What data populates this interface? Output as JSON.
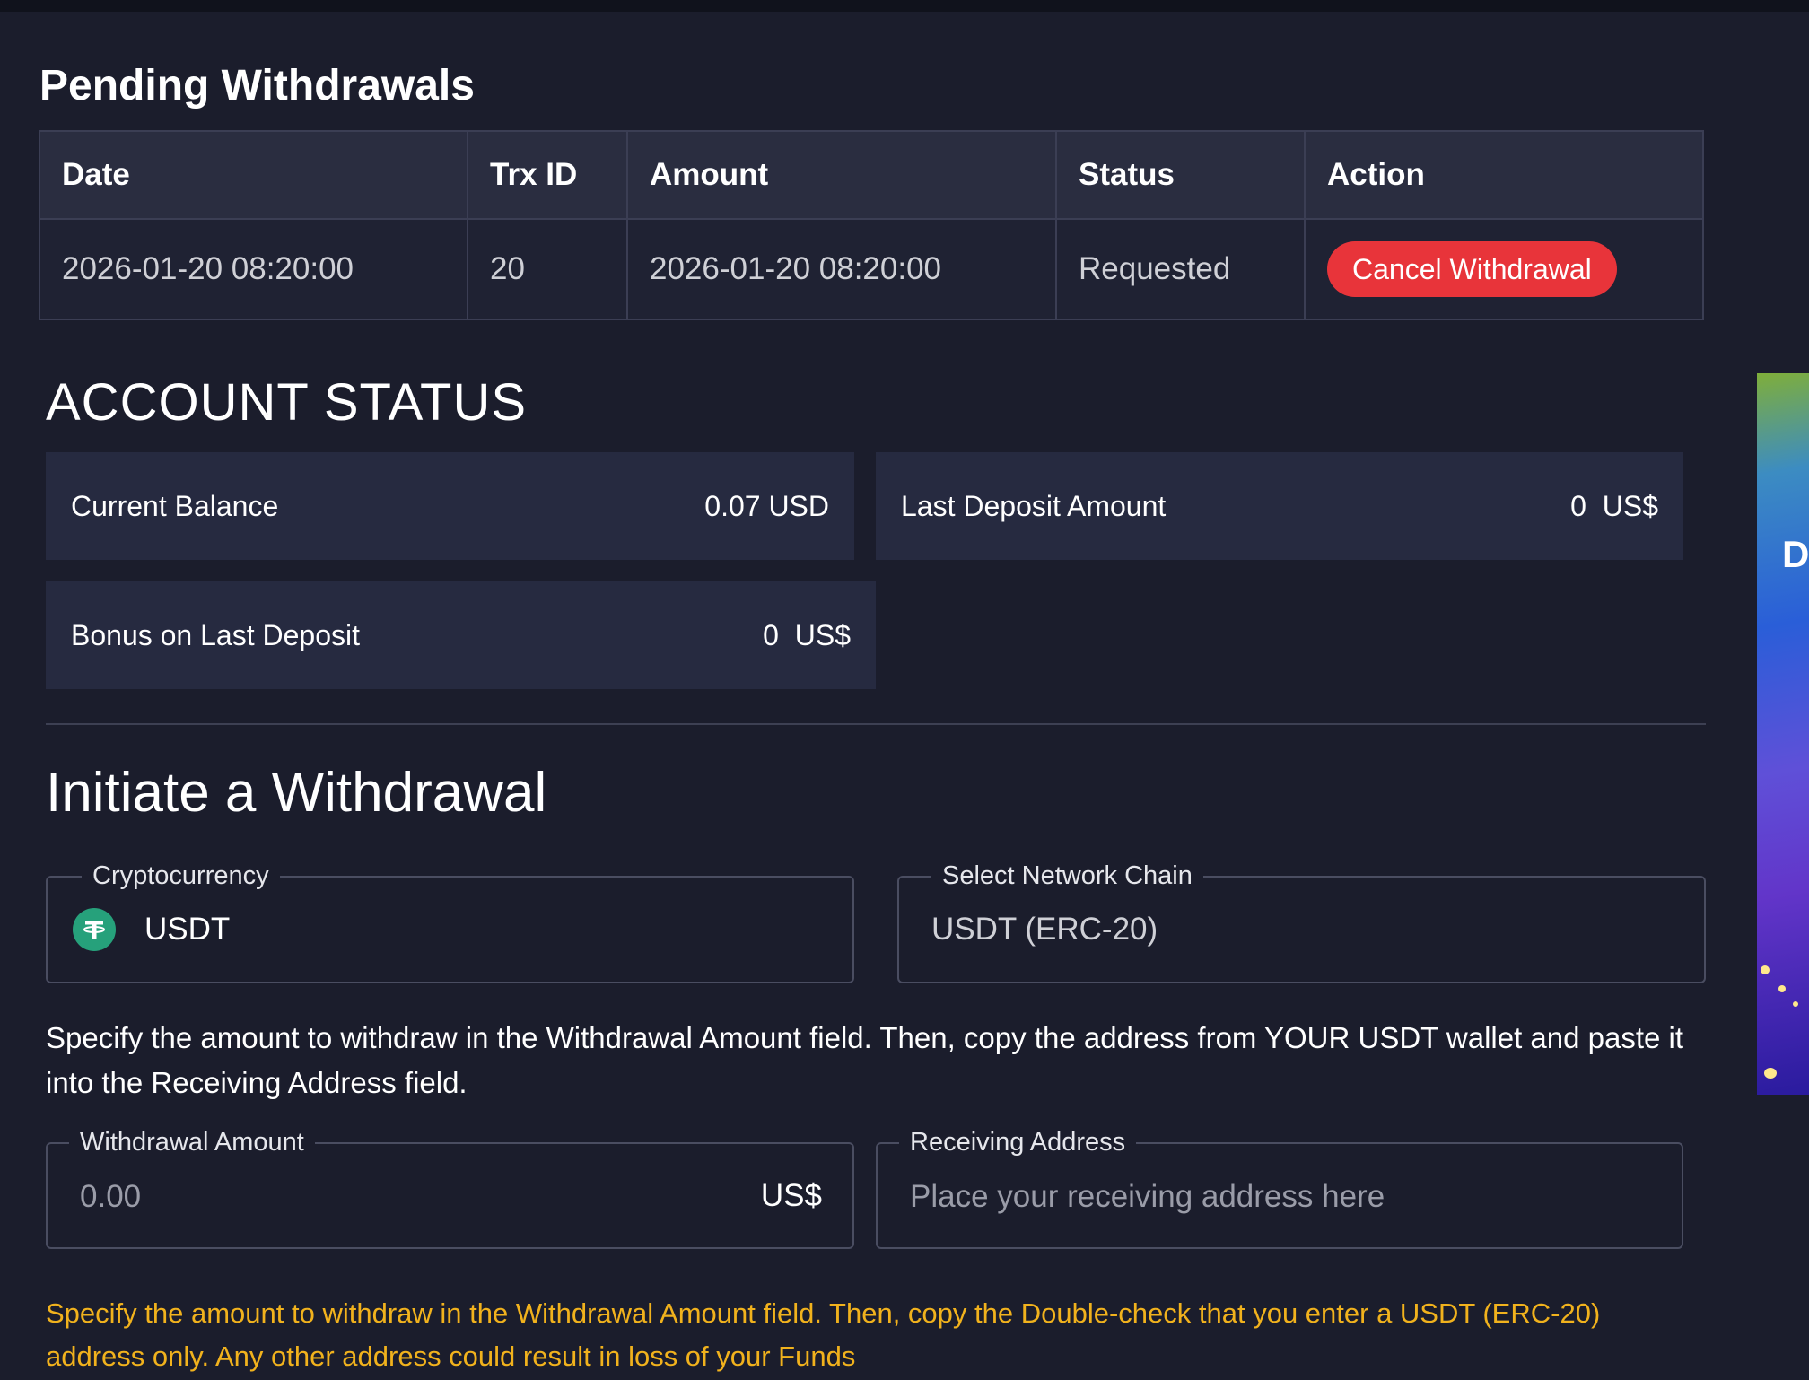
{
  "pending_withdrawals": {
    "title": "Pending Withdrawals",
    "columns": [
      "Date",
      "Trx ID",
      "Amount",
      "Status",
      "Action"
    ],
    "rows": [
      {
        "date": "2026-01-20 08:20:00",
        "trx_id": "20",
        "amount": "2026-01-20 08:20:00",
        "status": "Requested",
        "action_label": "Cancel Withdrawal"
      }
    ]
  },
  "account_status": {
    "title": "ACCOUNT STATUS",
    "current_balance": {
      "label": "Current Balance",
      "value": "0.07 USD"
    },
    "last_deposit": {
      "label": "Last Deposit Amount",
      "value": "0  US$"
    },
    "bonus_last_deposit": {
      "label": "Bonus on Last Deposit",
      "value": "0  US$"
    }
  },
  "withdrawal": {
    "title": "Initiate a Withdrawal",
    "crypto": {
      "legend": "Cryptocurrency",
      "value": "USDT",
      "icon": "tether-icon"
    },
    "network": {
      "legend": "Select Network Chain",
      "value": "USDT (ERC-20)"
    },
    "instruction": "Specify the amount to withdraw in the Withdrawal Amount field. Then, copy the address from YOUR USDT wallet and paste it into the Receiving Address field.",
    "amount_field": {
      "legend": "Withdrawal Amount",
      "placeholder": "0.00",
      "suffix": "US$"
    },
    "address_field": {
      "legend": "Receiving Address",
      "placeholder": "Place your receiving address here"
    },
    "warning": "Specify the amount to withdraw in the Withdrawal Amount field. Then, copy the Double-check that you enter a USDT (ERC-20) address only. Any other address could result in loss of your Funds"
  },
  "ad_banner": {
    "visible_text": "D"
  },
  "colors": {
    "background": "#1b1d2c",
    "cancel_button": "#e8343a",
    "warning_text": "#f1b21d",
    "tether_green": "#26a17b"
  }
}
